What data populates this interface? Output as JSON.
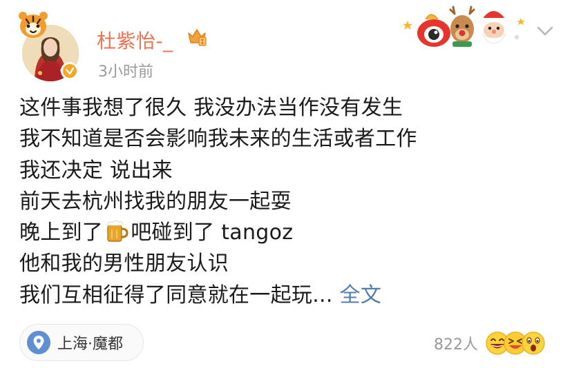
{
  "header": {
    "username": "杜紫怡-_",
    "timestamp": "3小时前"
  },
  "content": {
    "lines": [
      "这件事我想了很久 我没办法当作没有发生",
      "我不知道是否会影响我未来的生活或者工作",
      "我还决定 说出来",
      "前天去杭州找我的朋友一起耍"
    ],
    "line5_before": "晚上到了",
    "line5_emoji": "beer-mug-icon",
    "line5_after": "吧碰到了 tangoz",
    "line6": "他和我的男性朋友认识",
    "line7": "我们互相征得了同意就在一起玩...",
    "full_text_link": "全文"
  },
  "footer": {
    "location": "上海·魔都",
    "reaction_count": "822人"
  },
  "colors": {
    "username": "#eb7350",
    "link": "#507daf",
    "timestamp": "#999999",
    "location_icon": "#5d8fd2"
  }
}
